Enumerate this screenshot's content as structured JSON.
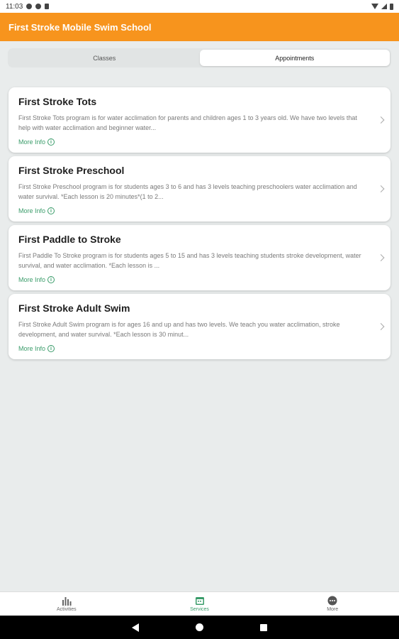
{
  "status_bar": {
    "time": "11:03"
  },
  "app_bar": {
    "title": "First Stroke Mobile Swim School"
  },
  "tabs": [
    {
      "label": "Classes",
      "active": false
    },
    {
      "label": "Appointments",
      "active": true
    }
  ],
  "services": [
    {
      "title": "First Stroke Tots",
      "description": "First Stroke Tots program is for water acclimation for parents and children ages 1 to 3 years old.  We have two levels that help with water acclimation and beginner water...",
      "more_info": "More Info"
    },
    {
      "title": "First Stroke Preschool",
      "description": "First Stroke Preschool program is for students ages 3 to 6 and has 3 levels teaching preschoolers water acclimation and water survival. *Each lesson is 20 minutes*(1 to 2...",
      "more_info": "More Info"
    },
    {
      "title": "First Paddle to Stroke",
      "description": "First Paddle To Stroke program is for students ages 5 to 15 and has 3 levels teaching students stroke development, water survival, and water acclimation. *Each lesson is ...",
      "more_info": "More Info"
    },
    {
      "title": "First Stroke Adult Swim",
      "description": "First Stroke Adult Swim program is for ages 16 and up and has two levels. We teach you water acclimation, stroke development, and water survival. *Each lesson is 30 minut...",
      "more_info": "More Info"
    }
  ],
  "bottom_nav": [
    {
      "label": "Activities",
      "icon": "bar-chart-icon",
      "active": false
    },
    {
      "label": "Services",
      "icon": "calendar-icon",
      "active": true
    },
    {
      "label": "More",
      "icon": "more-icon",
      "active": false
    }
  ],
  "colors": {
    "brand": "#f7941d",
    "accent": "#3a9c6a",
    "background": "#e9ecec"
  }
}
